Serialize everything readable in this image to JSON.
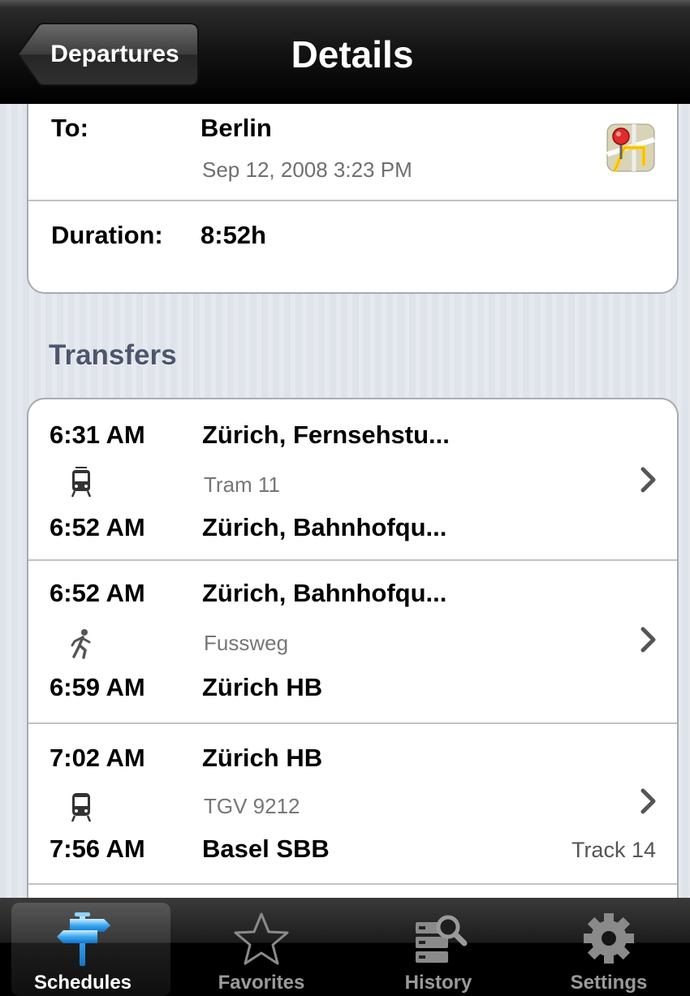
{
  "nav": {
    "back_label": "Departures",
    "title": "Details"
  },
  "summary": {
    "to_label": "To:",
    "to_station": "Berlin",
    "to_datetime": "Sep 12, 2008 3:23 PM",
    "duration_label": "Duration:",
    "duration_value": "8:52h"
  },
  "transfers": {
    "header": "Transfers",
    "items": [
      {
        "dep_time": "6:31 AM",
        "dep_station": "Zürich, Fernsehstu...",
        "mode_icon": "tram-icon",
        "line": "Tram 11",
        "arr_time": "6:52 AM",
        "arr_station": "Zürich, Bahnhofqu...",
        "track": ""
      },
      {
        "dep_time": "6:52 AM",
        "dep_station": "Zürich, Bahnhofqu...",
        "mode_icon": "walk-icon",
        "line": "Fussweg",
        "arr_time": "6:59 AM",
        "arr_station": "Zürich HB",
        "track": ""
      },
      {
        "dep_time": "7:02 AM",
        "dep_station": "Zürich HB",
        "mode_icon": "train-icon",
        "line": "TGV 9212",
        "arr_time": "7:56 AM",
        "arr_station": "Basel SBB",
        "track": "Track 14"
      }
    ]
  },
  "tabbar": {
    "selected": "Schedules",
    "tabs": [
      {
        "label": "Schedules",
        "icon": "signpost-icon"
      },
      {
        "label": "Favorites",
        "icon": "star-icon"
      },
      {
        "label": "History",
        "icon": "history-icon"
      },
      {
        "label": "Settings",
        "icon": "gear-icon"
      }
    ]
  }
}
